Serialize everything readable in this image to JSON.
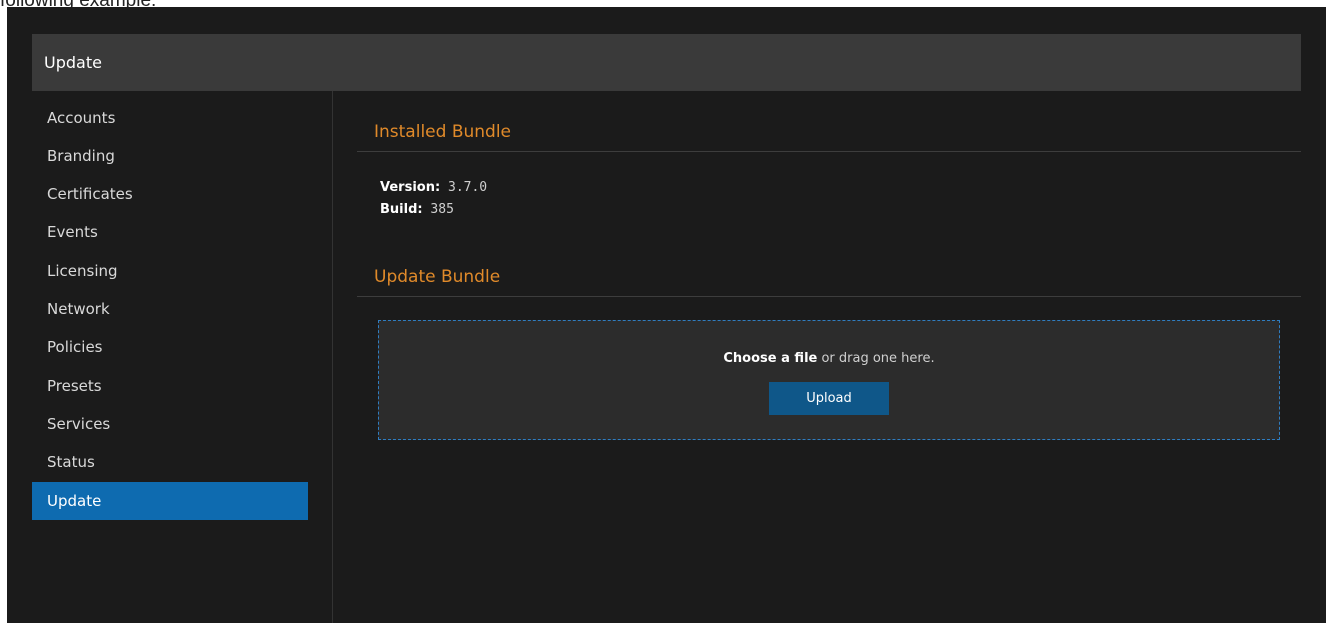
{
  "caption": "following example:",
  "header": {
    "title": "Update"
  },
  "sidebar": {
    "items": [
      {
        "label": "Accounts"
      },
      {
        "label": "Branding"
      },
      {
        "label": "Certificates"
      },
      {
        "label": "Events"
      },
      {
        "label": "Licensing"
      },
      {
        "label": "Network"
      },
      {
        "label": "Policies"
      },
      {
        "label": "Presets"
      },
      {
        "label": "Services"
      },
      {
        "label": "Status"
      },
      {
        "label": "Update",
        "active": true
      }
    ]
  },
  "installed": {
    "title": "Installed Bundle",
    "version_label": "Version:",
    "version_value": "3.7.0",
    "build_label": "Build:",
    "build_value": "385"
  },
  "update": {
    "title": "Update Bundle",
    "choose_label": "Choose a file",
    "drag_text": " or drag one here.",
    "upload_label": "Upload"
  },
  "colors": {
    "accent": "#0e6bb0",
    "section_title": "#e08a2a",
    "background": "#1b1b1b",
    "header": "#3a3a3a"
  }
}
